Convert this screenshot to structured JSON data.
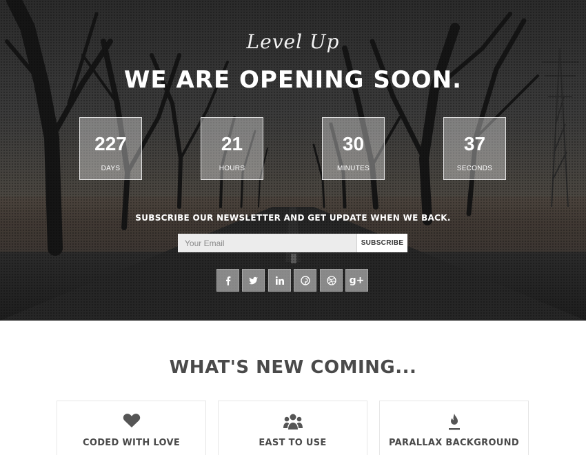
{
  "hero": {
    "script_title": "Level Up",
    "title": "WE ARE OPENING SOON.",
    "countdown": [
      {
        "value": "227",
        "label": "DAYS"
      },
      {
        "value": "21",
        "label": "HOURS"
      },
      {
        "value": "30",
        "label": "MINUTES"
      },
      {
        "value": "37",
        "label": "SECONDS"
      }
    ],
    "subscribe_text": "SUBSCRIBE OUR NEWSLETTER AND GET UPDATE WHEN WE BACK.",
    "email_placeholder": "Your Email",
    "subscribe_button": "SUBSCRIBE",
    "social": [
      {
        "icon": "facebook-icon"
      },
      {
        "icon": "twitter-icon"
      },
      {
        "icon": "linkedin-icon"
      },
      {
        "icon": "pinterest-icon"
      },
      {
        "icon": "dribbble-icon"
      },
      {
        "icon": "google-plus-icon",
        "glyph": "g+"
      }
    ]
  },
  "whats_new": {
    "title": "WHAT'S NEW COMING...",
    "features": [
      {
        "icon": "heart-icon",
        "title": "CODED WITH LOVE"
      },
      {
        "icon": "users-icon",
        "title": "EAST TO USE"
      },
      {
        "icon": "flame-icon",
        "title": "PARALLAX BACKGROUND"
      }
    ]
  },
  "colors": {
    "hero_overlay": "#2b2b2b",
    "heading_dark": "#4a4a4a",
    "input_bg": "#ececec"
  }
}
